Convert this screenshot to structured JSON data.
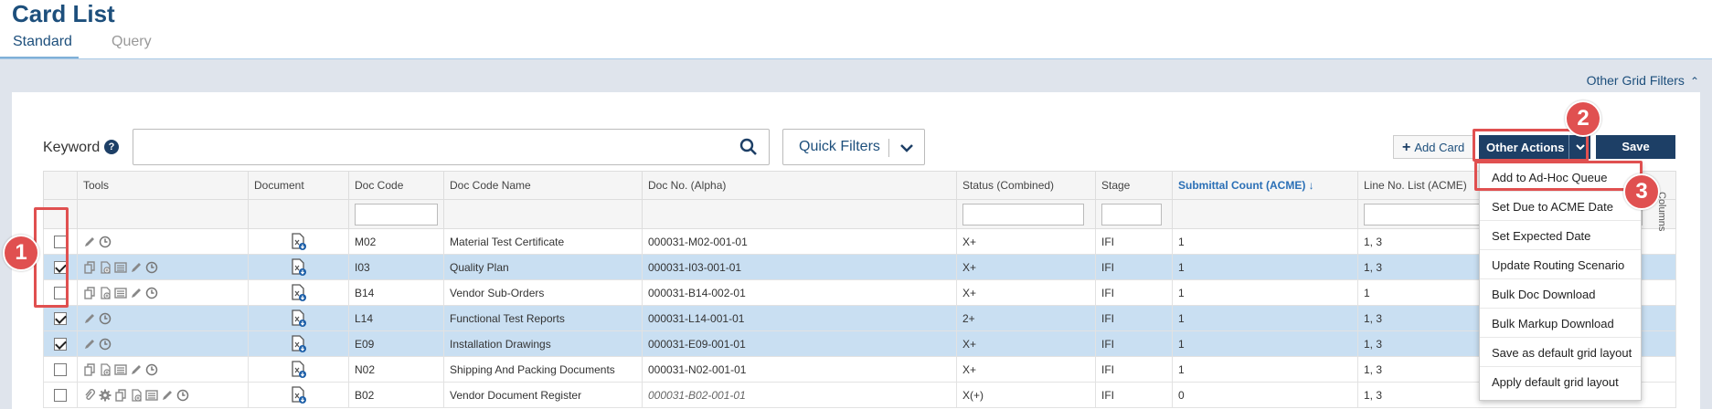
{
  "page": {
    "title": "Card List"
  },
  "tabs": [
    {
      "label": "Standard",
      "active": true
    },
    {
      "label": "Query",
      "active": false
    }
  ],
  "other_grid_filters": {
    "label": "Other Grid Filters"
  },
  "toolbar": {
    "keyword_label": "Keyword",
    "search_value": "",
    "quick_filters_label": "Quick Filters",
    "add_card_label": "Add Card",
    "other_actions_label": "Other Actions",
    "save_label": "Save"
  },
  "columns": [
    "",
    "Tools",
    "Document",
    "Doc Code",
    "Doc Code Name",
    "Doc No. (Alpha)",
    "Status (Combined)",
    "Stage",
    "Submittal Count (ACME)",
    "Line No. List (ACME)"
  ],
  "sorted_column": "Submittal Count (ACME)",
  "rows": [
    {
      "checked": false,
      "tools": [
        "pencil-icon",
        "clock-icon"
      ],
      "doc_code": "M02",
      "doc_code_name": "Material Test Certificate",
      "doc_no": "000031-M02-001-01",
      "status": "X+",
      "stage": "IFI",
      "submittal_count": "1",
      "line_no_list": "1, 3"
    },
    {
      "checked": true,
      "tools": [
        "copy-icon",
        "add-doc-icon",
        "list-icon",
        "pencil-icon",
        "clock-icon"
      ],
      "doc_code": "I03",
      "doc_code_name": "Quality Plan",
      "doc_no": "000031-I03-001-01",
      "status": "X+",
      "stage": "IFI",
      "submittal_count": "1",
      "line_no_list": "1, 3"
    },
    {
      "checked": false,
      "tools": [
        "copy-icon",
        "add-doc-icon",
        "list-icon",
        "pencil-icon",
        "clock-icon"
      ],
      "doc_code": "B14",
      "doc_code_name": "Vendor Sub-Orders",
      "doc_no": "000031-B14-002-01",
      "status": "X+",
      "stage": "IFI",
      "submittal_count": "1",
      "line_no_list": "1"
    },
    {
      "checked": true,
      "tools": [
        "pencil-icon",
        "clock-icon"
      ],
      "doc_code": "L14",
      "doc_code_name": "Functional Test Reports",
      "doc_no": "000031-L14-001-01",
      "status": "2+",
      "stage": "IFI",
      "submittal_count": "1",
      "line_no_list": "1, 3"
    },
    {
      "checked": true,
      "tools": [
        "pencil-icon",
        "clock-icon"
      ],
      "doc_code": "E09",
      "doc_code_name": "Installation Drawings",
      "doc_no": "000031-E09-001-01",
      "status": "X+",
      "stage": "IFI",
      "submittal_count": "1",
      "line_no_list": "1, 3"
    },
    {
      "checked": false,
      "tools": [
        "copy-icon",
        "add-doc-icon",
        "list-icon",
        "pencil-icon",
        "clock-icon"
      ],
      "doc_code": "N02",
      "doc_code_name": "Shipping And Packing Documents",
      "doc_no": "000031-N02-001-01",
      "status": "X+",
      "stage": "IFI",
      "submittal_count": "1",
      "line_no_list": "1, 3"
    },
    {
      "checked": false,
      "tools": [
        "paperclip-icon",
        "gear-icon",
        "copy-icon",
        "add-doc-icon",
        "list-icon",
        "pencil-icon",
        "clock-icon"
      ],
      "doc_code": "B02",
      "doc_code_name": "Vendor Document Register",
      "doc_no": "000031-B02-001-01",
      "status": "X(+)",
      "stage": "IFI",
      "submittal_count": "0",
      "line_no_list": "1, 3"
    }
  ],
  "columns_tab_label": "Columns",
  "other_actions_menu": [
    "Add to Ad-Hoc Queue",
    "Set Due to ACME Date",
    "Set Expected Date",
    "Update Routing Scenario",
    "Bulk Doc Download",
    "Bulk Markup Download",
    "Save as default grid layout",
    "Apply default grid layout"
  ],
  "annotations": [
    "1",
    "2",
    "3"
  ],
  "colors": {
    "brand": "#1d4f7c",
    "button": "#1d3f66",
    "selected_row": "#c9dff2",
    "annotation": "#e05050"
  }
}
